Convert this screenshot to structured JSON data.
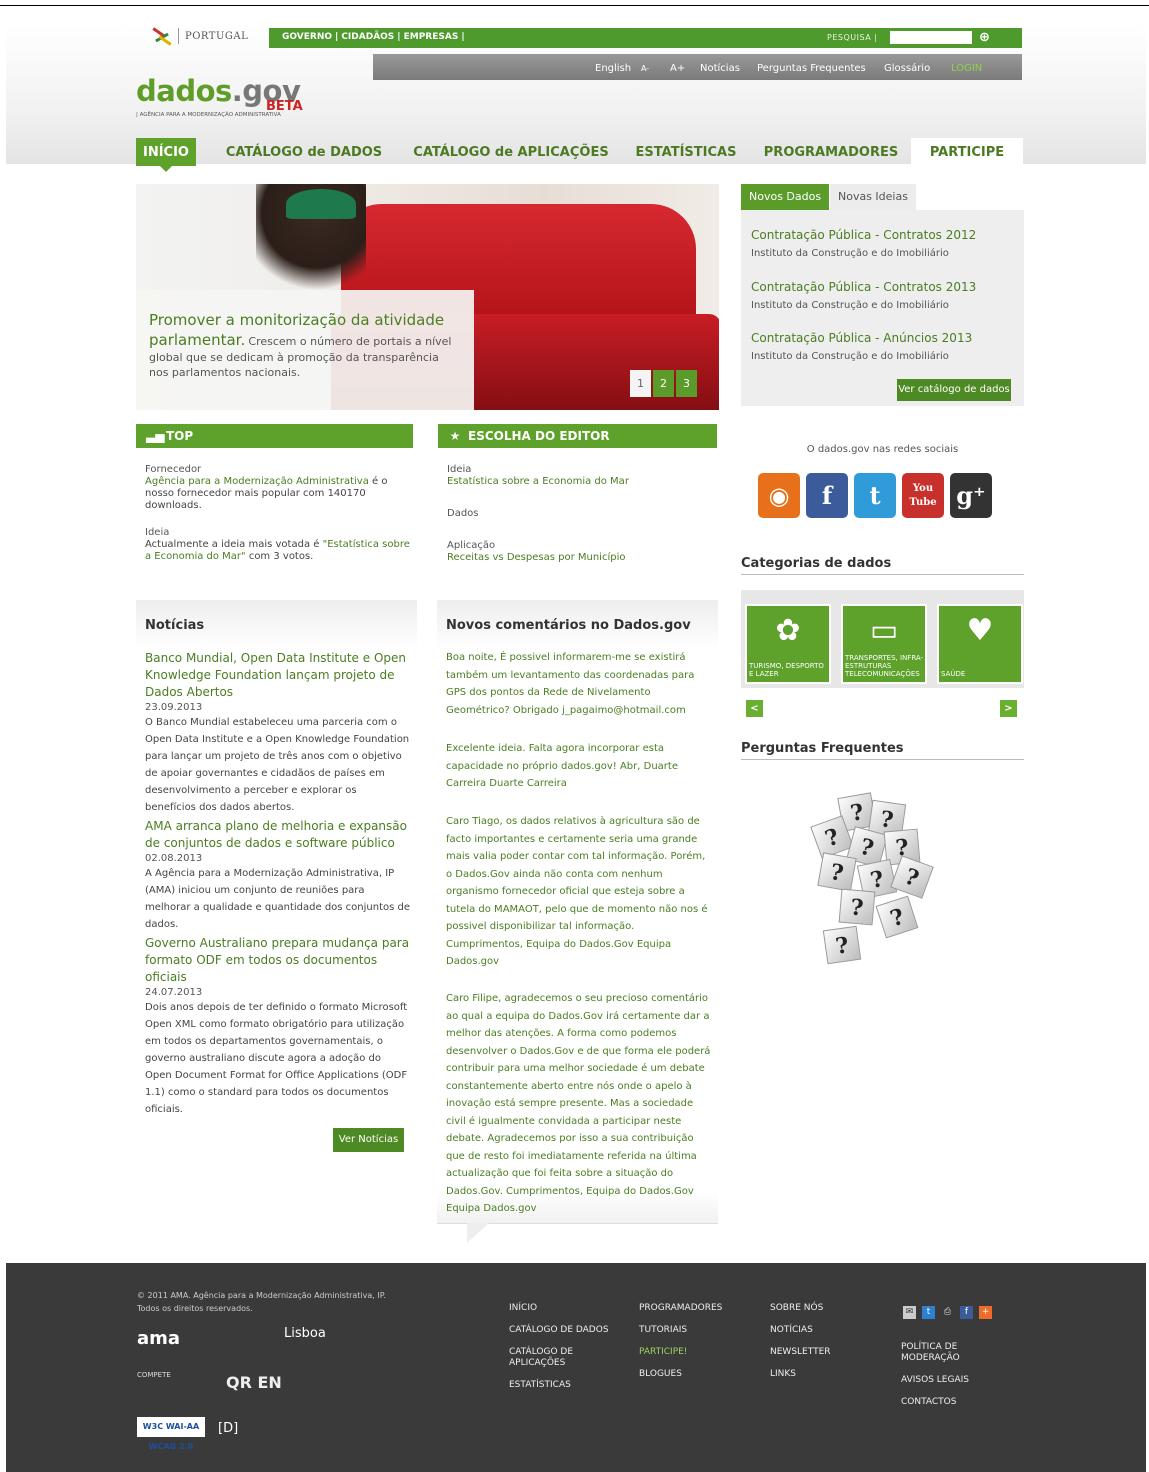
{
  "top": {
    "country": "PORTUGAL",
    "audience_links": [
      "GOVERNO",
      "CIDADÃOS",
      "EMPRESAS"
    ],
    "search_label": "PESQUISA",
    "search_value": "",
    "search_go": "⊕"
  },
  "utility_nav": [
    "English",
    "A-",
    "A+",
    "Notícias",
    "Perguntas Frequentes",
    "Glossário",
    "LOGIN"
  ],
  "logo": {
    "dados": "dados",
    "gov": ".gov",
    "beta": "BETA",
    "tagline": "| AGÊNCIA PARA A MODERNIZAÇÃO ADMINISTRATIVA"
  },
  "main_nav": [
    "INÍCIO",
    "CATÁLOGO de DADOS",
    "CATÁLOGO de APLICAÇÕES",
    "ESTATÍSTICAS",
    "PROGRAMADORES",
    "PARTICIPE"
  ],
  "hero": {
    "title": "Promover a monitorização da atividade parlamentar.",
    "body": "Crescem o número de portais a nível global que se dedicam à promoção da transparência nos parlamentos nacionais.",
    "pages": [
      "1",
      "2",
      "3"
    ]
  },
  "novos_dados": {
    "tab_active": "Novos Dados",
    "tab_other": "Novas Ideias",
    "items": [
      {
        "title": "Contratação Pública - Contratos 2012",
        "source": "Instituto da Construção e do Imobiliário"
      },
      {
        "title": "Contratação Pública - Contratos 2013",
        "source": "Instituto da Construção e do Imobiliário"
      },
      {
        "title": "Contratação Pública - Anúncios 2013",
        "source": "Instituto da Construção e do Imobiliário"
      }
    ],
    "button": "Ver catálogo de dados"
  },
  "top_section": {
    "title": "TOP",
    "fornecedor_label": "Fornecedor",
    "fornecedor_link": "Agência para a Modernização Administrativa",
    "fornecedor_text": " é o nosso fornecedor mais popular com 140170 downloads.",
    "ideia_label": "Ideia",
    "ideia_text1": "Actualmente a ideia mais votada é ",
    "ideia_link": "\"Estatística sobre a Economia do Mar\"",
    "ideia_text2": " com 3 votos."
  },
  "editor": {
    "title": "ESCOLHA DO EDITOR",
    "ideia_label": "Ideia",
    "ideia_link": "Estatística sobre a Economia do Mar",
    "dados_label": "Dados",
    "aplicacao_label": "Aplicação",
    "aplicacao_link": "Receitas vs Despesas por Município"
  },
  "social": {
    "title": "O dados.gov nas redes sociais",
    "icons": [
      {
        "name": "rss-icon",
        "glyph": "◉",
        "color": "#e7711b"
      },
      {
        "name": "facebook-icon",
        "glyph": "f",
        "color": "#3b5b9a"
      },
      {
        "name": "twitter-icon",
        "glyph": "t",
        "color": "#2f9bd9"
      },
      {
        "name": "youtube-icon",
        "glyph": "You Tube",
        "color": "#c8302b"
      },
      {
        "name": "google-plus-icon",
        "glyph": "g⁺",
        "color": "#333333"
      }
    ]
  },
  "categorias": {
    "title": "Categorias de dados",
    "items": [
      {
        "label": "TURISMO, DESPORTO E LAZER",
        "glyph": "✿"
      },
      {
        "label": "TRANSPORTES, INFRA-ESTRUTURAS TELECOMUNICAÇÕES",
        "glyph": "▭"
      },
      {
        "label": "SAÚDE",
        "glyph": "♥"
      }
    ],
    "prev": "<",
    "next": ">"
  },
  "faq": {
    "title": "Perguntas Frequentes"
  },
  "noticias": {
    "title": "Notícias",
    "items": [
      {
        "title": "Banco Mundial, Open Data Institute e Open Knowledge Foundation lançam projeto de Dados Abertos",
        "date": "23.09.2013",
        "body": "O Banco Mundial estabeleceu uma parceria com o Open Data Institute e a Open Knowledge Foundation para lançar um projeto de três anos com o objetivo de apoiar governantes e cidadãos de países em desenvolvimento a perceber e explorar os benefícios dos dados abertos."
      },
      {
        "title": "AMA arranca plano de melhoria e expansão de conjuntos de dados e software público",
        "date": "02.08.2013",
        "body": "A Agência para a Modernização Administrativa, IP (AMA) iniciou um conjunto de reuniões para melhorar a qualidade e quantidade dos conjuntos de dados."
      },
      {
        "title": "Governo Australiano prepara mudança para formato ODF em todos os documentos oficiais",
        "date": "24.07.2013",
        "body": "Dois anos depois de ter definido o formato Microsoft Open XML como formato obrigatório para utilização em todos os departamentos governamentais, o governo australiano discute agora a adoção do Open Document Format for Office Applications (ODF 1.1) como o standard para todos os documentos oficiais."
      }
    ],
    "button": "Ver Notícias"
  },
  "comentarios": {
    "title": "Novos comentários no Dados.gov",
    "items": [
      "Boa noite, É possivel informarem-me se existirá também um levantamento das coordenadas para GPS dos pontos da Rede de Nivelamento Geométrico? Obrigado j_pagaimo@hotmail.com",
      "Excelente ideia. Falta agora incorporar esta capacidade no próprio dados.gov! Abr, Duarte Carreira Duarte Carreira",
      "Caro Tiago, os dados relativos à agricultura são de facto importantes e certamente seria uma grande mais valia poder contar com tal informação. Porém, o Dados.Gov ainda não conta com nenhum organismo fornecedor oficial que esteja sobre a tutela do MAMAOT, pelo que de momento não nos é possivel disponibilizar tal informação. Cumprimentos, Equipa do Dados.Gov Equipa Dados.gov",
      "Caro Filipe, agradecemos o seu precioso comentário ao qual a equipa do Dados.Gov irá certamente dar a melhor das atenções. A forma como podemos desenvolver o Dados.Gov e de que forma ele poderá contribuir para uma melhor sociedade é um debate constantemente aberto entre nós onde o apelo à inovação está sempre presente. Mas a sociedade civil é igualmente convidada a participar neste debate. Agradecemos por isso a sua contribuição que de resto foi imediatamente referida na última actualização que foi feita sobre a situação do Dados.Gov. Cumprimentos, Equipa do Dados.Gov Equipa Dados.gov"
    ]
  },
  "footer": {
    "copyright": "© 2011 AMA. Agência para a Modernização Administrativa, IP.",
    "rights": "Todos os direitos reservados.",
    "ama": "ama",
    "lisboa": "Lisboa",
    "compete": "COMPETE",
    "qren": "QR EN",
    "wai": "W3C WAI-AA WCAG 2.0",
    "d": "[D]",
    "col1": [
      "INÍCIO",
      "CATÁLOGO DE DADOS",
      "CATÁLOGO DE APLICAÇÕES",
      "ESTATÍSTICAS"
    ],
    "col2": [
      "PROGRAMADORES",
      "TUTORIAIS",
      "PARTICIPE!",
      "BLOGUES"
    ],
    "col3": [
      "SOBRE NÓS",
      "NOTÍCIAS",
      "NEWSLETTER",
      "LINKS"
    ],
    "col4": [
      "POLÍTICA DE MODERAÇÃO",
      "AVISOS LEGAIS",
      "CONTACTOS"
    ]
  }
}
